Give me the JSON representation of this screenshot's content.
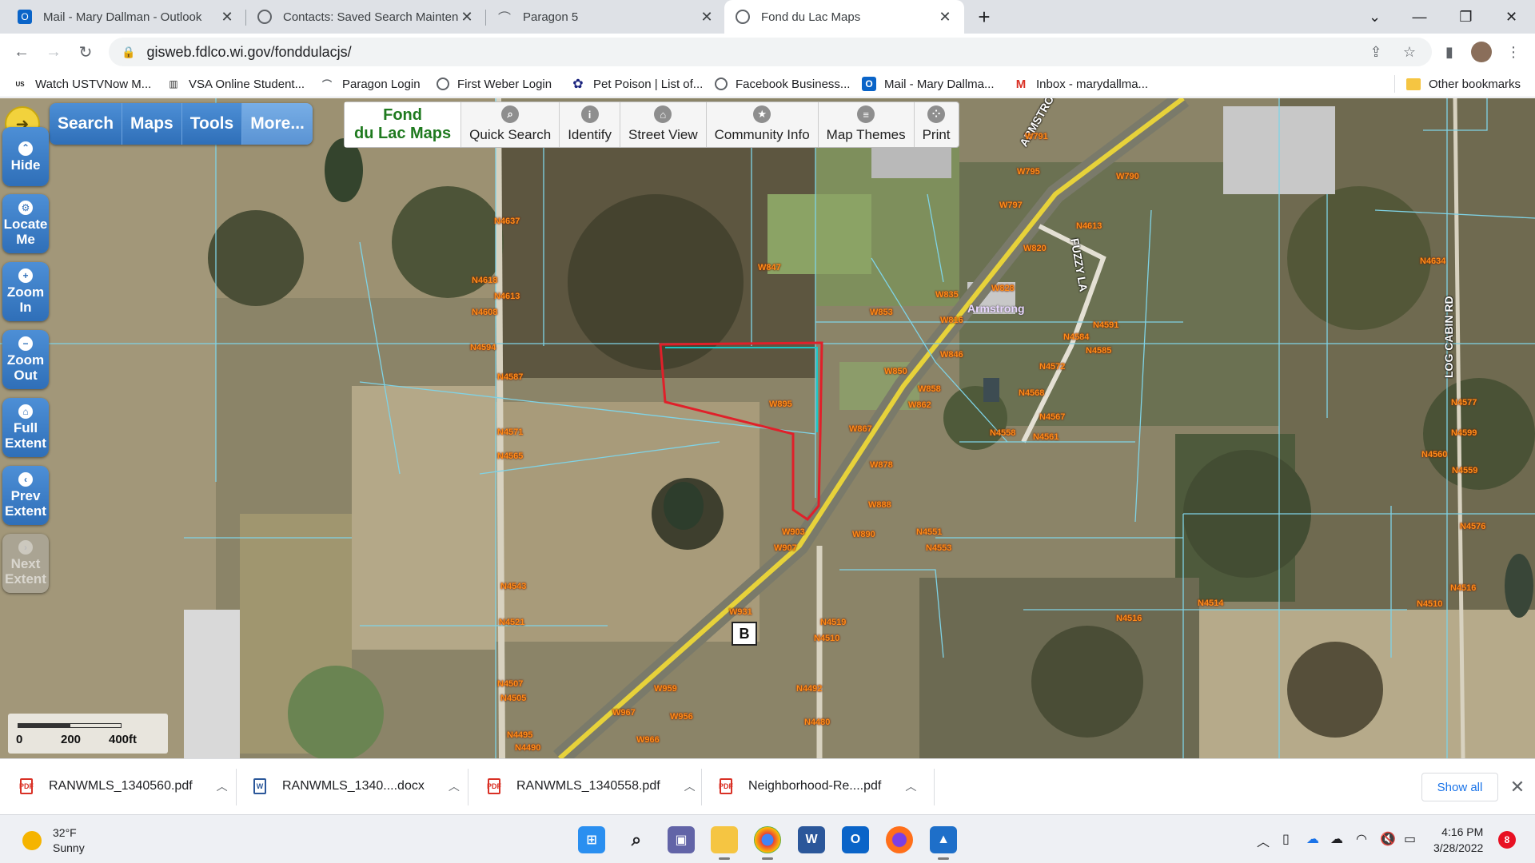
{
  "browser": {
    "tabs": [
      {
        "title": "Mail - Mary Dallman - Outlook",
        "icon": "outlook-icon"
      },
      {
        "title": "Contacts: Saved Search Maintena",
        "icon": "globe-icon"
      },
      {
        "title": "Paragon 5",
        "icon": "paragon-icon"
      },
      {
        "title": "Fond du Lac Maps",
        "icon": "globe-icon"
      }
    ],
    "new_tab_symbol": "+",
    "url": "gisweb.fdlco.wi.gov/fonddulacjs/",
    "bookmarks": [
      {
        "label": "Watch USTVNow M...",
        "icon": "ustvnow-icon"
      },
      {
        "label": "VSA Online Student...",
        "icon": "vsa-icon"
      },
      {
        "label": "Paragon Login",
        "icon": "paragon-icon"
      },
      {
        "label": "First Weber Login",
        "icon": "globe-icon"
      },
      {
        "label": "Pet Poison | List of...",
        "icon": "paw-icon"
      },
      {
        "label": "Facebook Business...",
        "icon": "facebook-icon"
      },
      {
        "label": "Mail - Mary Dallma...",
        "icon": "outlook-icon"
      },
      {
        "label": "Inbox - marydallma...",
        "icon": "gmail-icon"
      }
    ],
    "other_bookmarks": "Other bookmarks"
  },
  "map_app": {
    "menu": [
      "Search",
      "Maps",
      "Tools",
      "More..."
    ],
    "brand_line1": "Fond",
    "brand_line2": "du Lac Maps",
    "tools": [
      {
        "label": "Quick Search",
        "icon": "search-icon"
      },
      {
        "label": "Identify",
        "icon": "info-icon"
      },
      {
        "label": "Street View",
        "icon": "street-view-icon"
      },
      {
        "label": "Community Info",
        "icon": "star-icon"
      },
      {
        "label": "Map Themes",
        "icon": "layers-icon"
      },
      {
        "label": "Print",
        "icon": "print-icon"
      }
    ],
    "left_nav": [
      {
        "line1": "Hide",
        "line2": "",
        "icon": "chevron-up-icon",
        "enabled": true
      },
      {
        "line1": "Locate",
        "line2": "Me",
        "icon": "gear-icon",
        "enabled": true
      },
      {
        "line1": "Zoom",
        "line2": "In",
        "icon": "plus-icon",
        "enabled": true
      },
      {
        "line1": "Zoom",
        "line2": "Out",
        "icon": "minus-icon",
        "enabled": true
      },
      {
        "line1": "Full",
        "line2": "Extent",
        "icon": "home-icon",
        "enabled": true
      },
      {
        "line1": "Prev",
        "line2": "Extent",
        "icon": "arrow-left-icon",
        "enabled": true
      },
      {
        "line1": "Next",
        "line2": "Extent",
        "icon": "arrow-right-icon",
        "enabled": false
      }
    ],
    "roads": [
      "ARMSTRONG RD",
      "FUZZY LA",
      "LOG CABIN RD"
    ],
    "place": "Armstrong",
    "route_shield": "B",
    "address_labels": [
      "W791",
      "W795",
      "W797",
      "W790",
      "N4637",
      "N4618",
      "N4613",
      "N4608",
      "N4594",
      "N4587",
      "N4571",
      "N4565",
      "W847",
      "W835",
      "W828",
      "W820",
      "W816",
      "W853",
      "N4613",
      "N4591",
      "N4584",
      "N4585",
      "N4572",
      "W846",
      "W850",
      "W858",
      "W862",
      "N4568",
      "N4567",
      "N4558",
      "N4561",
      "W867",
      "W878",
      "W895",
      "W888",
      "W890",
      "N4551",
      "N4553",
      "W903",
      "W907",
      "N4543",
      "N4521",
      "W931",
      "N4519",
      "N4510",
      "N4507",
      "N4505",
      "N4495",
      "N4490",
      "W959",
      "W967",
      "W956",
      "W966",
      "N4492",
      "N4480",
      "N4634",
      "N4577",
      "N4599",
      "N4560",
      "N4559",
      "N4576",
      "N4516",
      "N4514",
      "N4510",
      "N4516"
    ],
    "scale": {
      "ticks": [
        "0",
        "200",
        "400ft"
      ]
    }
  },
  "downloads": {
    "items": [
      {
        "name": "RANWMLS_1340560.pdf",
        "type": "pdf"
      },
      {
        "name": "RANWMLS_1340....docx",
        "type": "docx"
      },
      {
        "name": "RANWMLS_1340558.pdf",
        "type": "pdf"
      },
      {
        "name": "Neighborhood-Re....pdf",
        "type": "pdf"
      }
    ],
    "show_all": "Show all"
  },
  "taskbar": {
    "weather_temp": "32°F",
    "weather_desc": "Sunny",
    "time": "4:16 PM",
    "date": "3/28/2022",
    "notification_count": "8",
    "apps": [
      "windows-start-icon",
      "search-icon",
      "teams-chat-icon",
      "file-explorer-icon",
      "chrome-icon",
      "word-icon",
      "outlook-icon",
      "firefox-icon",
      "photos-icon"
    ]
  },
  "colors": {
    "accent_blue": "#2f6fb8",
    "parcel_outline": "#e0202a",
    "parcel_lines": "#7fd3e6",
    "address_label": "#ff8c1a",
    "brand_green": "#1f7a1f"
  }
}
